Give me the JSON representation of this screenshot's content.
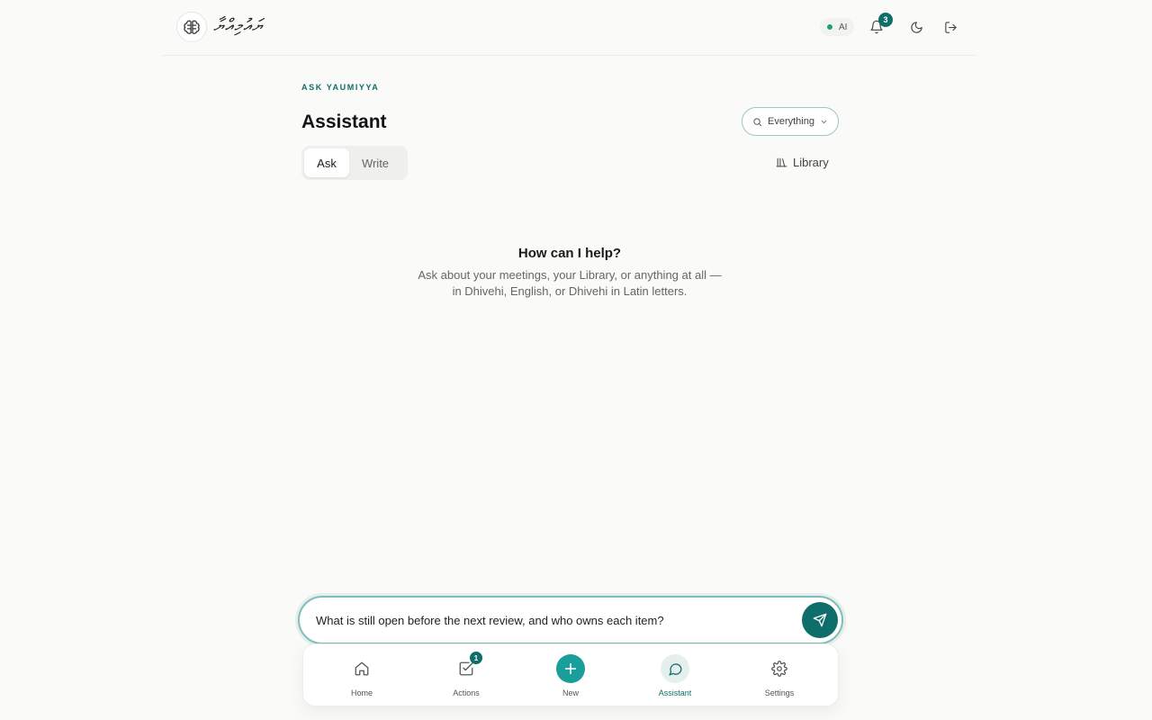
{
  "header": {
    "logo_text": "ޔައުމިއްޔާ",
    "ai_label": "AI",
    "notification_count": "3"
  },
  "main": {
    "eyebrow": "ASK YAUMIYYA",
    "title": "Assistant",
    "scope_select": {
      "value": "Everything"
    },
    "tabs": [
      {
        "label": "Ask",
        "active": true
      },
      {
        "label": "Write",
        "active": false
      }
    ],
    "library_label": "Library",
    "empty_title": "How can I help?",
    "empty_line1": "Ask about your meetings, your Library, or anything at all —",
    "empty_line2": "in Dhivehi, English, or Dhivehi in Latin letters."
  },
  "composer": {
    "value": "What is still open before the next review, and who owns each item?"
  },
  "nav": {
    "items": [
      {
        "label": "Home",
        "icon": "home-icon"
      },
      {
        "label": "Actions",
        "icon": "checkbox-icon",
        "badge": "1"
      },
      {
        "label": "New",
        "icon": "plus-icon"
      },
      {
        "label": "Assistant",
        "icon": "chat-bubble-icon",
        "active": true
      },
      {
        "label": "Settings",
        "icon": "gear-icon"
      }
    ]
  },
  "colors": {
    "accent": "#0f6e6a",
    "accent_light": "#1a9e9a",
    "background": "#fafaf8",
    "status_dot": "#1aa37a"
  }
}
